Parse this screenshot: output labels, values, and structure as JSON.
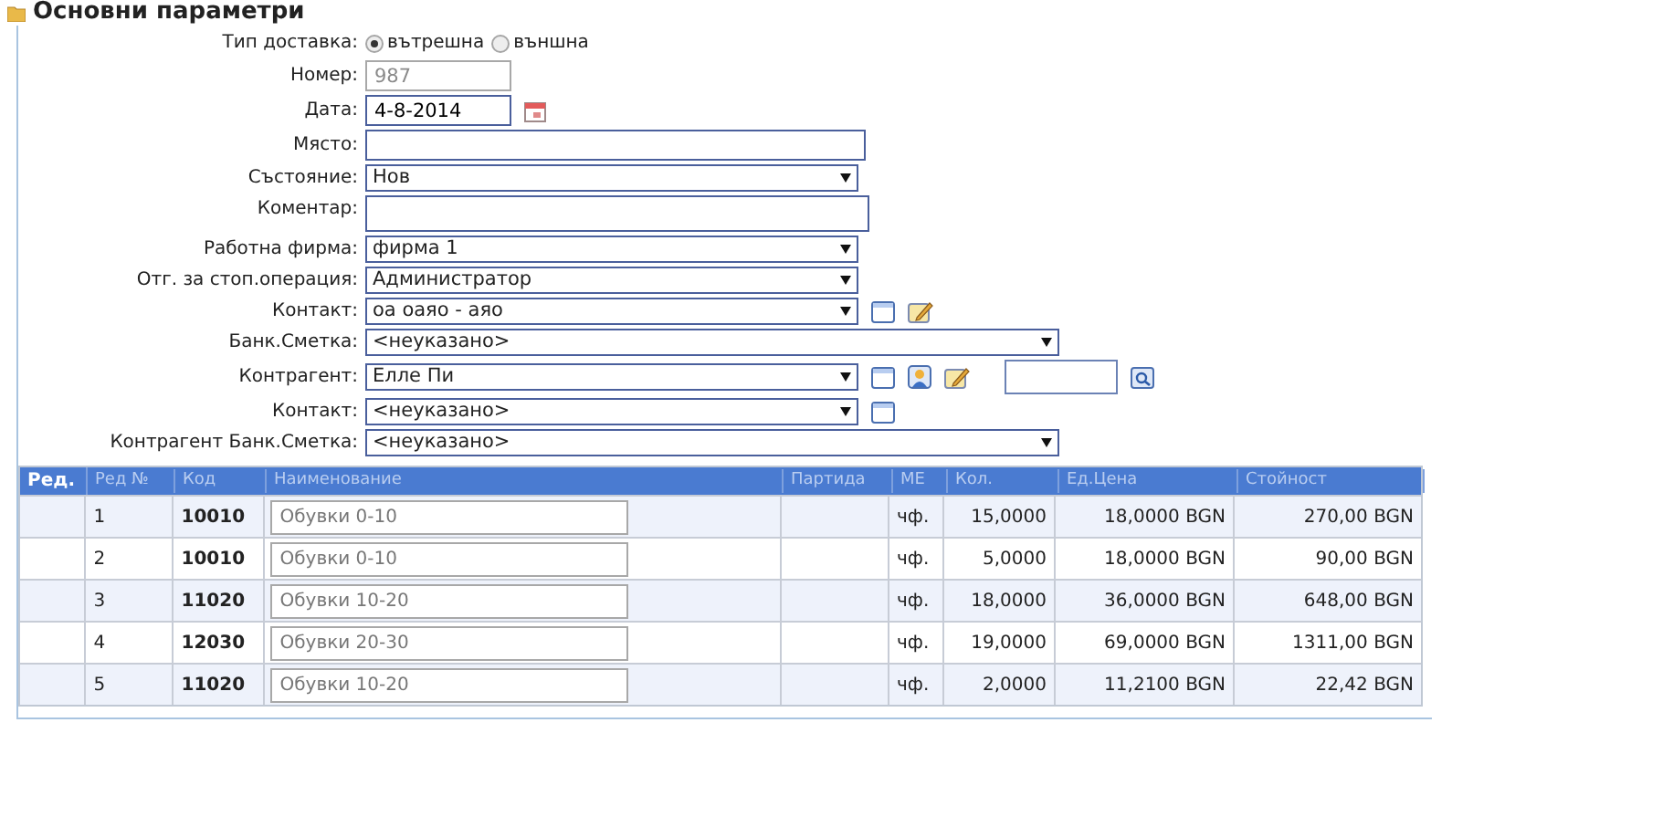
{
  "section_title": "Основни параметри",
  "form": [
    {
      "kind": "radio",
      "label": "Тип доставка:",
      "options": [
        {
          "label": "вътрешна",
          "selected": true
        },
        {
          "label": "външна",
          "selected": false
        }
      ]
    },
    {
      "kind": "text",
      "label": "Номер:",
      "value": "987",
      "disabled": true
    },
    {
      "kind": "date",
      "label": "Дата:",
      "value": "4-8-2014",
      "disabled": false
    },
    {
      "kind": "longtext",
      "label": "Място:",
      "disabled": false
    },
    {
      "kind": "select",
      "label": "Състояние:",
      "value": "Нов"
    },
    {
      "kind": "textarea",
      "label": "Коментар:"
    },
    {
      "kind": "select",
      "label": "Работна фирма:",
      "value": "фирма 1"
    },
    {
      "kind": "select",
      "label": "Отг. за стоп.операция:",
      "value": "Администратор"
    },
    {
      "kind": "select",
      "label": "Контакт:",
      "value": "оа оаяо - аяо"
    },
    {
      "kind": "longselect",
      "label": "Банк.Сметка:",
      "value": "<неуказано>"
    },
    {
      "kind": "select",
      "label": "Контрагент:",
      "value": "Елле Пи"
    },
    {
      "kind": "select",
      "label": "Контакт:",
      "value": "<неуказано>"
    },
    {
      "kind": "longselect",
      "label": "Контрагент Банк.Сметка:",
      "value": "<неуказано>"
    }
  ],
  "table": {
    "columns": [
      "Ред.",
      "Ред №",
      "Код",
      "Наименование",
      "Партида",
      "МЕ",
      "Кол.",
      "Ед.Цена",
      "Стойност"
    ],
    "rows": [
      {
        "row_no": "1",
        "code": "10010",
        "name": "Обувки 0-10",
        "unit": "чф.",
        "qty": "15,0000",
        "unit_price": "18,0000 BGN",
        "total": "270,00 BGN"
      },
      {
        "row_no": "2",
        "code": "10010",
        "name": "Обувки 0-10",
        "unit": "чф.",
        "qty": "5,0000",
        "unit_price": "18,0000 BGN",
        "total": "90,00 BGN"
      },
      {
        "row_no": "3",
        "code": "11020",
        "name": "Обувки 10-20",
        "unit": "чф.",
        "qty": "18,0000",
        "unit_price": "36,0000 BGN",
        "total": "648,00 BGN"
      },
      {
        "row_no": "4",
        "code": "12030",
        "name": "Обувки 20-30",
        "unit": "чф.",
        "qty": "19,0000",
        "unit_price": "69,0000 BGN",
        "total": "1311,00 BGN"
      },
      {
        "row_no": "5",
        "code": "11020",
        "name": "Обувки 10-20",
        "unit": "чф.",
        "qty": "2,0000",
        "unit_price": "11,2100 BGN",
        "total": "22,42 BGN"
      }
    ]
  }
}
